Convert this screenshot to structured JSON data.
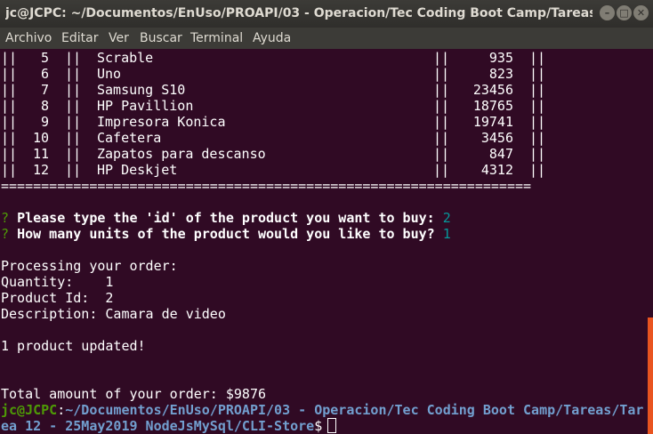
{
  "window": {
    "title": "jc@JCPC: ~/Documentos/EnUso/PROAPI/03 - Operacion/Tec Coding Boot Camp/Tareas/Tarea...",
    "close_glyph": "✕",
    "minimize_glyph": "–",
    "maximize_glyph": "□"
  },
  "menu": [
    "Archivo",
    "Editar",
    "Ver",
    "Buscar",
    "Terminal",
    "Ayuda"
  ],
  "table_rows": [
    {
      "sep1": "||",
      "id": "5",
      "sep2": "||",
      "name": "Scrable",
      "sep3": "||",
      "price": "935",
      "sep4": "||"
    },
    {
      "sep1": "||",
      "id": "6",
      "sep2": "||",
      "name": "Uno",
      "sep3": "||",
      "price": "823",
      "sep4": "||"
    },
    {
      "sep1": "||",
      "id": "7",
      "sep2": "||",
      "name": "Samsung S10",
      "sep3": "||",
      "price": "23456",
      "sep4": "||"
    },
    {
      "sep1": "||",
      "id": "8",
      "sep2": "||",
      "name": "HP Pavillion",
      "sep3": "||",
      "price": "18765",
      "sep4": "||"
    },
    {
      "sep1": "||",
      "id": "9",
      "sep2": "||",
      "name": "Impresora Konica",
      "sep3": "||",
      "price": "19741",
      "sep4": "||"
    },
    {
      "sep1": "||",
      "id": "10",
      "sep2": "||",
      "name": "Cafetera",
      "sep3": "||",
      "price": "3456",
      "sep4": "||"
    },
    {
      "sep1": "||",
      "id": "11",
      "sep2": "||",
      "name": "Zapatos para descanso",
      "sep3": "||",
      "price": "847",
      "sep4": "||"
    },
    {
      "sep1": "||",
      "id": "12",
      "sep2": "||",
      "name": "HP Deskjet",
      "sep3": "||",
      "price": "4312",
      "sep4": "||"
    }
  ],
  "separator": "==================================================================",
  "prompts": [
    {
      "mark": "?",
      "question": "Please type the 'id' of the product you want to buy:",
      "answer": "2"
    },
    {
      "mark": "?",
      "question": "How many units of the product would you like to buy?",
      "answer": "1"
    }
  ],
  "order": {
    "heading": "Processing your order:",
    "quantity_line": "Quantity:    1",
    "product_id_line": "Product Id:  2",
    "description_line": "Description: Camara de video",
    "updated_line": "1 product updated!",
    "total_line": "Total amount of your order: $9876"
  },
  "shell_prompt": {
    "user_host": "jc@JCPC",
    "colon": ":",
    "path_line1": "~/Documentos/EnUso/PROAPI/03 - Operacion/Tec Coding Boot Camp/Tareas/Tar",
    "path_line2": "ea 12 - 25May2019 NodeJsMySql/CLI-Store",
    "dollar": "$"
  }
}
